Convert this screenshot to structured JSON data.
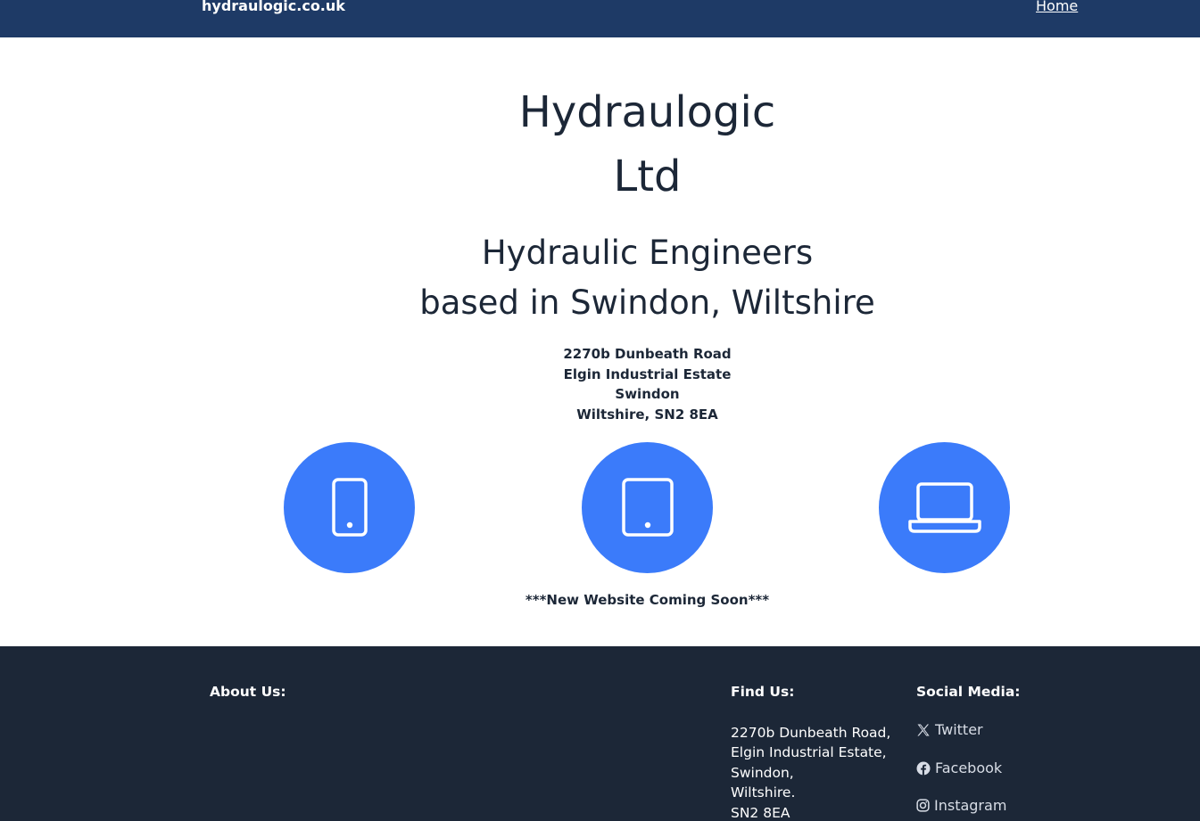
{
  "header": {
    "brand": "hydraulogic.co.uk",
    "nav_home": "Home"
  },
  "hero": {
    "title_line1": "Hydraulogic",
    "title_line2": "Ltd",
    "subtitle_line1": "Hydraulic Engineers",
    "subtitle_line2": "based in Swindon, Wiltshire",
    "address": [
      "2270b Dunbeath Road",
      "Elgin Industrial Estate",
      "Swindon",
      "Wiltshire, SN2 8EA"
    ]
  },
  "devices": {
    "icons": [
      "mobile-phone-icon",
      "tablet-icon",
      "laptop-icon"
    ],
    "circle_color": "#3b7bfa"
  },
  "notice": "***New Website Coming Soon***",
  "footer": {
    "about_heading": "About Us:",
    "find_heading": "Find Us:",
    "find_address": [
      "2270b Dunbeath Road,",
      "Elgin Industrial Estate,",
      "Swindon,",
      "Wiltshire.",
      "SN2 8EA"
    ],
    "social_heading": "Social Media:",
    "social": {
      "twitter": "Twitter",
      "facebook": "Facebook",
      "instagram": "Instagram"
    }
  },
  "colors": {
    "header_bg": "#1e3a66",
    "footer_bg": "#1c2737",
    "accent": "#3b7bfa",
    "text": "#1c2737"
  }
}
